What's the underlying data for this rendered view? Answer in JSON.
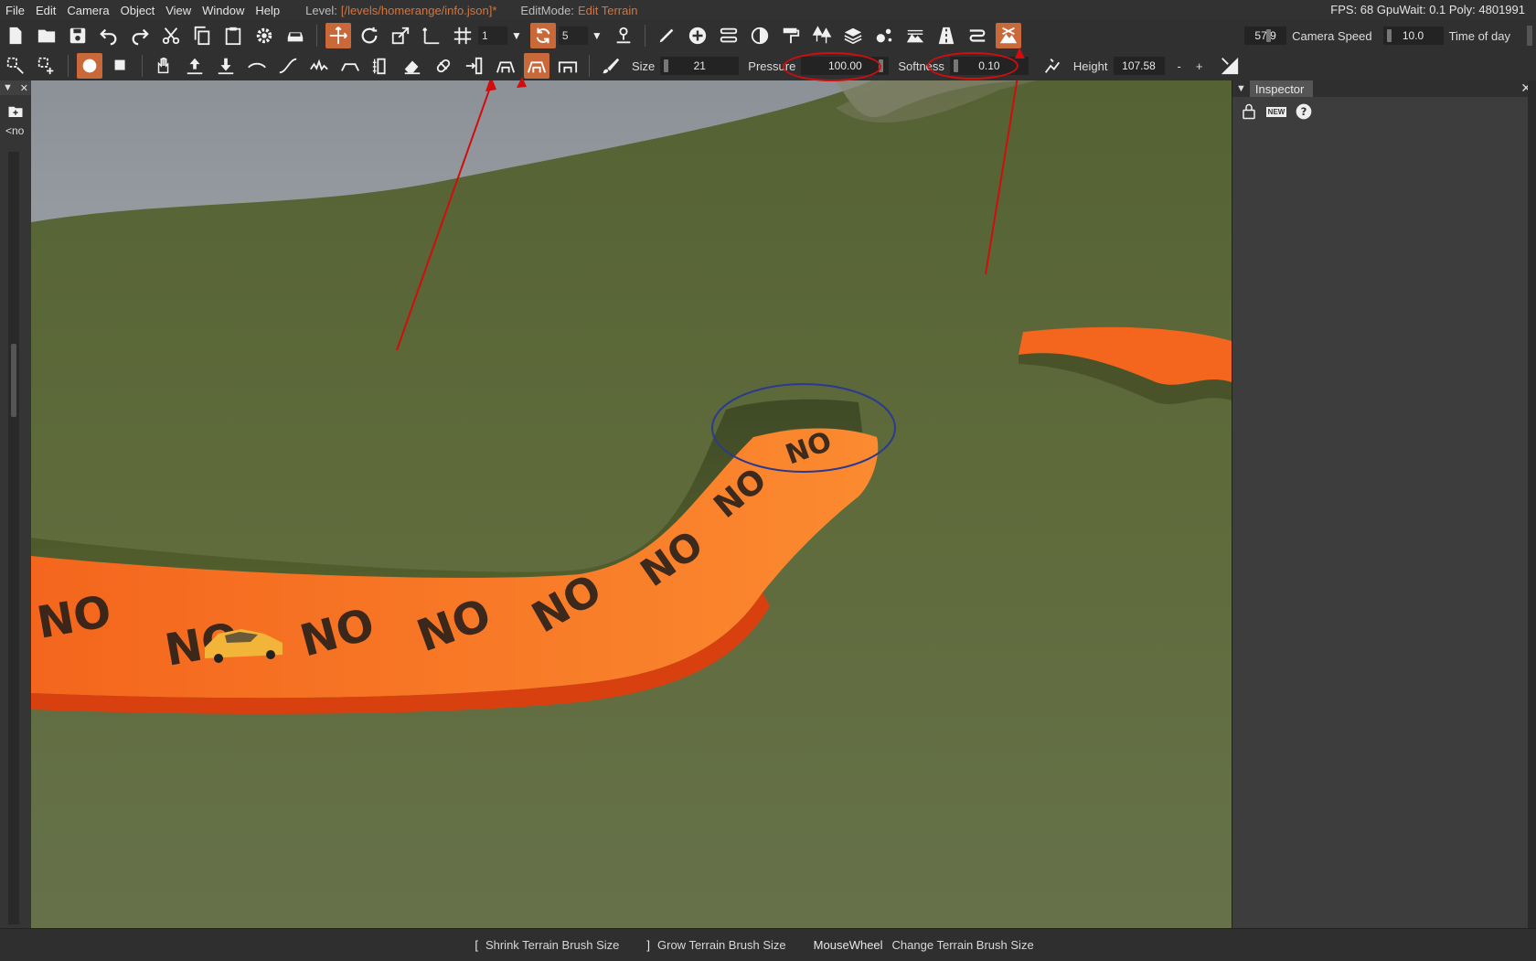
{
  "menubar": {
    "items": [
      "File",
      "Edit",
      "Camera",
      "Object",
      "View",
      "Window",
      "Help"
    ],
    "level_label": "Level:",
    "level_value": "[/levels/homerange/info.json]*",
    "editmode_label": "EditMode:",
    "editmode_value": "Edit Terrain",
    "stats": "FPS: 68  GpuWait: 0.1  Poly: 4801991"
  },
  "toolbar1": {
    "snap_value": "1",
    "rotate_snap_value": "5",
    "camera_speed_value": "57.9",
    "camera_speed_label": "Camera Speed",
    "time_of_day_value": "10.0",
    "time_of_day_label": "Time of day"
  },
  "toolbar2": {
    "size_label": "Size",
    "size_value": "21",
    "pressure_label": "Pressure",
    "pressure_value": "100.00",
    "softness_label": "Softness",
    "softness_value": "0.10",
    "height_label": "Height",
    "height_value": "107.58",
    "minus": "-",
    "plus": "+"
  },
  "left_panel": {
    "label": "<no"
  },
  "inspector": {
    "title": "Inspector",
    "new_label": "NEW"
  },
  "road_text": "NO",
  "statusbar": [
    {
      "key": "[",
      "desc": "Shrink Terrain Brush Size"
    },
    {
      "key": "]",
      "desc": "Grow Terrain Brush Size"
    },
    {
      "key": "MouseWheel",
      "desc": "Change Terrain Brush Size"
    }
  ],
  "colors": {
    "accent": "#c9693a",
    "road": "#f26a1f",
    "grass": "#5d6b3a",
    "annotation": "#d10d0d"
  }
}
